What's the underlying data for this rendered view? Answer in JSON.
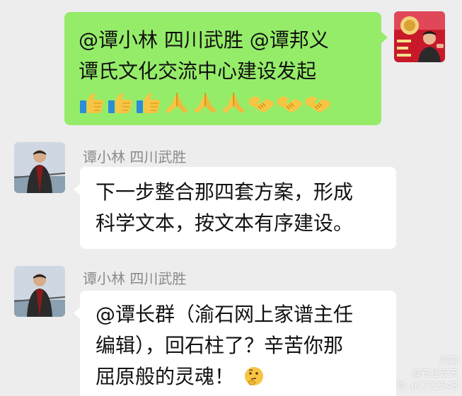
{
  "chat": {
    "outgoing": {
      "line1": "@谭小林  四川武胜  @谭邦义",
      "line2": "谭氏文化交流中心建设发起",
      "emojis": [
        "thumbs-up-icon",
        "thumbs-up-icon",
        "thumbs-up-icon",
        "praying-hands-icon",
        "praying-hands-icon",
        "praying-hands-icon",
        "handshake-icon",
        "handshake-icon",
        "handshake-icon"
      ]
    },
    "messages": [
      {
        "sender": "谭小林  四川武胜",
        "lines": [
          "下一步整合那四套方案，形成",
          "科学文本，按文本有序建设。"
        ]
      },
      {
        "sender": "谭小林  四川武胜",
        "lines": [
          "@谭长群（渝石网上家谱主任",
          "编辑），回石柱了？辛苦你那",
          "屈原般的灵魂！"
        ],
        "trailing_emoji": "thinking-face-icon"
      }
    ]
  },
  "watermark": {
    "brand": "美篇",
    "author": "@石柱云天",
    "id": "号: 61722543"
  },
  "colors": {
    "background": "#ededed",
    "outgoing_bubble": "#95ec69",
    "incoming_bubble": "#ffffff",
    "sender_name": "#8a8a8a"
  }
}
